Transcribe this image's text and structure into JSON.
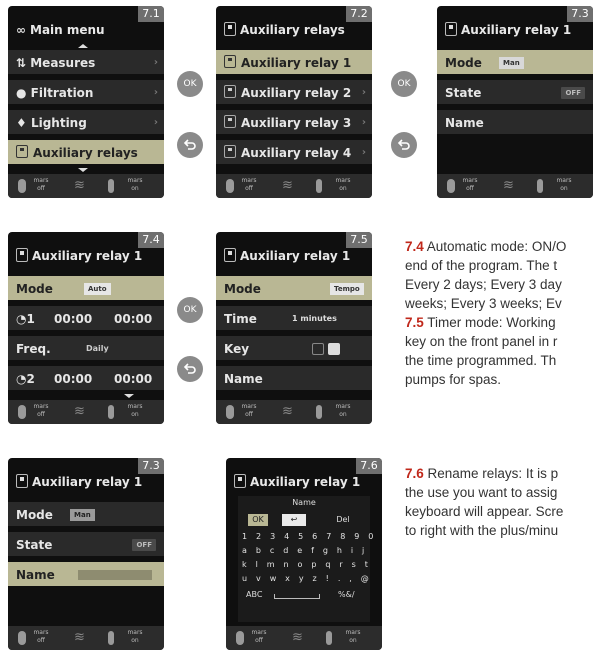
{
  "screens": {
    "s71": {
      "num": "7.1",
      "title": "Main menu",
      "items": [
        "Measures",
        "Filtration",
        "Lighting",
        "Auxiliary relays"
      ]
    },
    "s72": {
      "num": "7.2",
      "title": "Auxiliary relays",
      "items": [
        "Auxiliary relay 1",
        "Auxiliary relay 2",
        "Auxiliary relay 3",
        "Auxiliary relay 4"
      ]
    },
    "s73": {
      "num": "7.3",
      "title": "Auxiliary relay 1",
      "mode": "Mode",
      "mode_val": "Man",
      "state": "State",
      "state_val": "OFF",
      "name": "Name"
    },
    "s74": {
      "num": "7.4",
      "title": "Auxiliary relay 1",
      "mode": "Mode",
      "mode_val": "Auto",
      "p1": "1",
      "p1_on": "00:00",
      "p1_off": "00:00",
      "freq": "Freq.",
      "freq_val": "Daily",
      "p2": "2",
      "p2_on": "00:00",
      "p2_off": "00:00"
    },
    "s75": {
      "num": "7.5",
      "title": "Auxiliary relay 1",
      "mode": "Mode",
      "mode_val": "Tempo",
      "time": "Time",
      "time_val": "1 minutes",
      "key": "Key",
      "name": "Name"
    },
    "s73b": {
      "num": "7.3",
      "title": "Auxiliary relay 1",
      "mode": "Mode",
      "mode_val": "Man",
      "state": "State",
      "state_val": "OFF",
      "name": "Name"
    },
    "s76": {
      "num": "7.6",
      "title": "Auxiliary relay 1",
      "kb_title": "Name",
      "ok": "OK",
      "del": "Del",
      "row1": "1 2 3 4 5 6 7 8 9 0",
      "row2": "a b c d e f g h i j",
      "row3": "k l m n o p q r s t",
      "row4": "u v w x y z ! . , @",
      "abc": "ABC",
      "sym": "%&/"
    }
  },
  "footer": {
    "left_top": "mars",
    "left_bottom": "off",
    "right_top": "mars",
    "right_bottom": "on"
  },
  "nav": {
    "ok": "OK"
  },
  "text": {
    "p74_num": "7.4",
    "p74_l1": " Automatic mode: ON/O",
    "p74_l2": "end of the program. The t",
    "p74_l3": "Every 2 days; Every 3 day",
    "p74_l4": "weeks; Every 3 weeks; Ev",
    "p75_num": "7.5",
    "p75_l1": " Timer mode: Working",
    "p75_l2": "key on the front panel in r",
    "p75_l3": "the time programmed. Th",
    "p75_l4": "pumps for spas.",
    "p76_num": "7.6",
    "p76_l1": " Rename relays: It is p",
    "p76_l2": "the use you want to assig",
    "p76_l3": "keyboard will appear. Scre",
    "p76_l4": "to right with the plus/minu"
  },
  "colors": {
    "highlight": "#b9b794",
    "screen_bg": "#0f0f0f",
    "row_bg": "#2a2a2a",
    "accent_text": "#c0281b",
    "nav_button": "#8a8a8a"
  }
}
